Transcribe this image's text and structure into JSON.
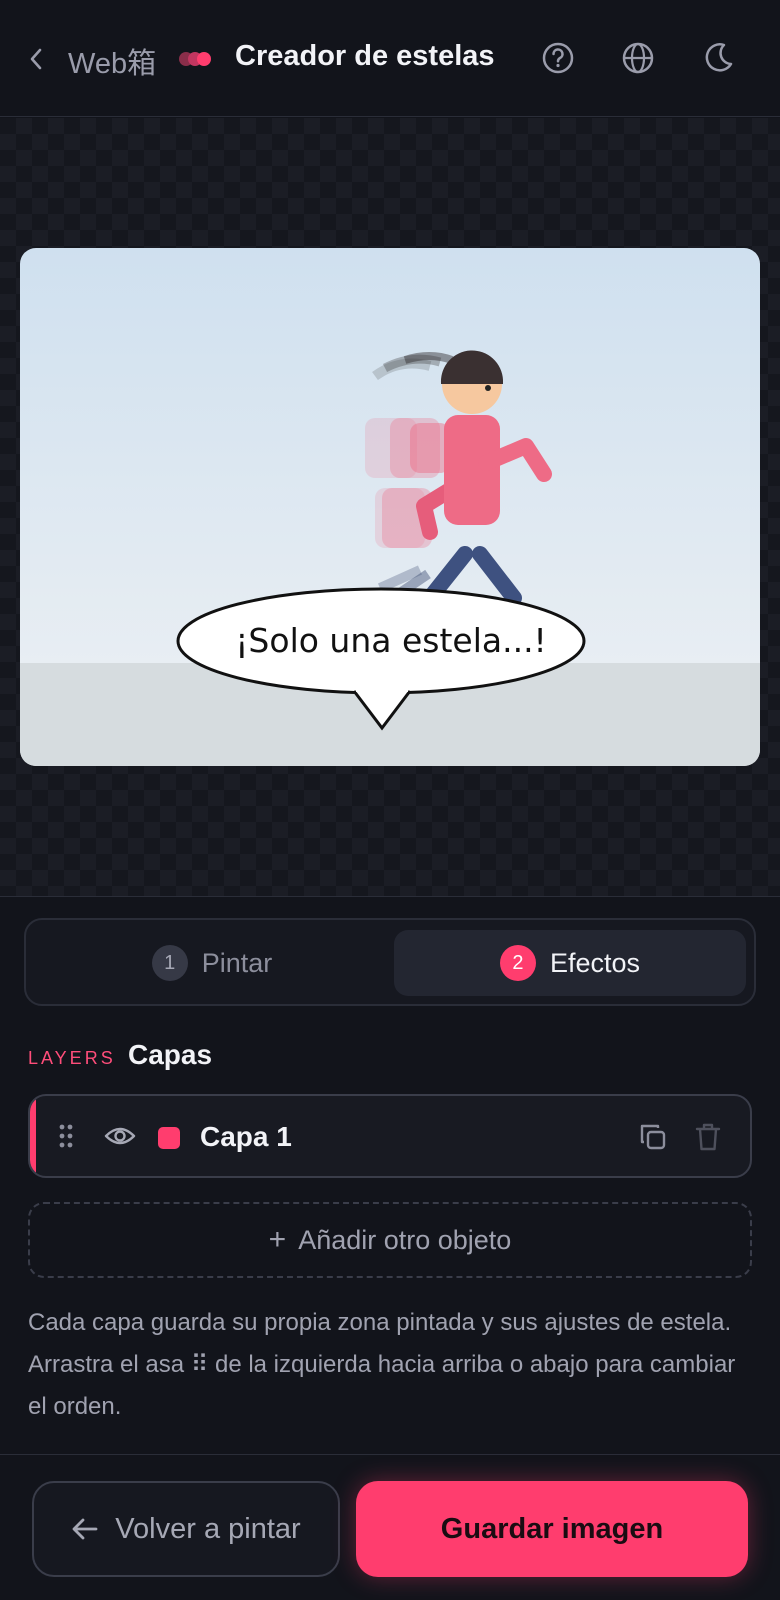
{
  "header": {
    "brand": "Web箱",
    "title": "Creador de estelas"
  },
  "scene": {
    "bubble_text": "¡Solo una estela...!"
  },
  "steps": [
    {
      "number": "1",
      "label": "Pintar",
      "active": false
    },
    {
      "number": "2",
      "label": "Efectos",
      "active": true
    }
  ],
  "layers": {
    "kicker": "LAYERS",
    "title": "Capas",
    "items": [
      {
        "name": "Capa 1",
        "color": "#ff3d6e",
        "visible": true
      }
    ],
    "add_label": "Añadir otro objeto",
    "help_text": "Cada capa guarda su propia zona pintada y sus ajustes de estela. Arrastra el asa ⠿ de la izquierda hacia arriba o abajo para cambiar el orden."
  },
  "actions": {
    "back_label": "Volver a pintar",
    "save_label": "Guardar imagen"
  },
  "colors": {
    "accent": "#ff3d6e",
    "background": "#12141b"
  }
}
